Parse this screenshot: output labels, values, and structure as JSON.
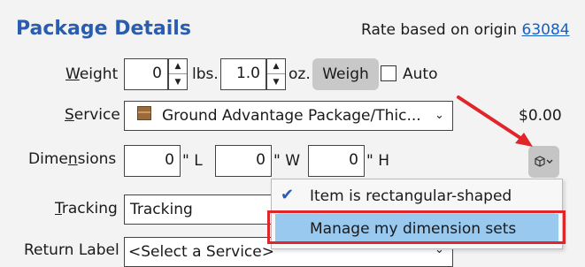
{
  "header": {
    "title": "Package Details",
    "rate_prefix": "Rate based on origin ",
    "origin_zip": "63084"
  },
  "weight": {
    "label_pre": "",
    "label_u": "W",
    "label_post": "eight",
    "lbs_value": "0",
    "lbs_unit": "lbs.",
    "oz_value": "1.0",
    "oz_unit": "oz.",
    "weigh_label": "Weigh",
    "auto_label": "Auto"
  },
  "service": {
    "label_pre": "",
    "label_u": "S",
    "label_post": "ervice",
    "selected": "Ground Advantage Package/Thic...",
    "price": "$0.00"
  },
  "dimensions": {
    "label_pre": "Dime",
    "label_u": "n",
    "label_post": "sions",
    "length": "0",
    "length_unit": "\" L",
    "width": "0",
    "width_unit": "\" W",
    "height": "0",
    "height_unit": "\" H"
  },
  "tracking": {
    "label_pre": "",
    "label_u": "T",
    "label_post": "racking",
    "value": "Tracking"
  },
  "return_label": {
    "label": "Return Label",
    "selected": "<Select a Service>"
  },
  "dimensions_menu": {
    "items": [
      {
        "label": "Item is rectangular-shaped",
        "checked": true
      },
      {
        "label": "Manage my dimension sets",
        "checked": false
      }
    ]
  },
  "colors": {
    "title": "#2a5db0",
    "link": "#1560c8",
    "menu_highlight": "#99c9ef",
    "annotation_red": "#e0262a"
  }
}
